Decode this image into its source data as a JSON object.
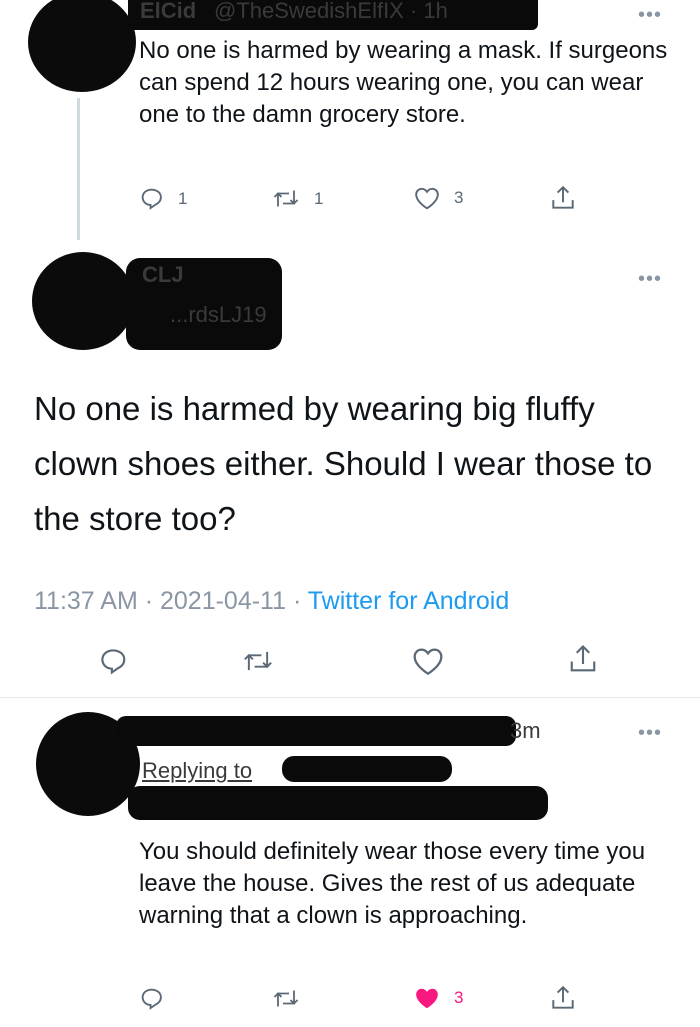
{
  "tweet1": {
    "name": "ElCid",
    "handle_time": "@TheSwedishElfIX · 1h",
    "more": "•••",
    "text": "No one is harmed by wearing a mask. If surgeons can spend 12 hours wearing one, you can wear one to the damn grocery store.",
    "replies": "1",
    "retweets": "1",
    "likes": "3"
  },
  "main_tweet": {
    "name": "CLJ",
    "handle": "...rdsLJ19",
    "more": "•••",
    "text": "No one is harmed by wearing big fluffy clown shoes either. Should I wear those to the store too?",
    "meta_time": "11:37 AM · 2021-04-11 · ",
    "meta_source": "Twitter for Android"
  },
  "reply": {
    "time": "3m",
    "replying_to": "Replying to",
    "more": "•••",
    "text": "You should definitely wear those every time you leave the house. Gives the rest of us adequate warning that a clown is approaching.",
    "likes": "3"
  },
  "colors": {
    "link": "#1d9bf0",
    "muted": "#8a96a3",
    "like_active": "#f91880"
  },
  "icons": [
    "reply-icon",
    "retweet-icon",
    "like-icon",
    "share-icon"
  ]
}
